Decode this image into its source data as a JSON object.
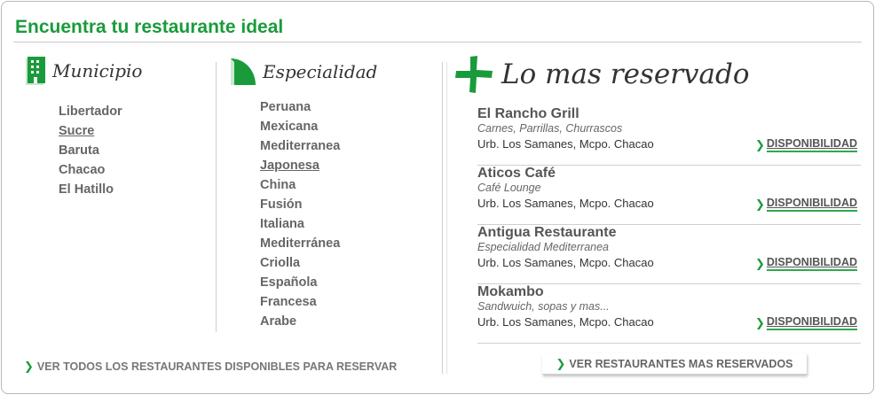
{
  "header": {
    "title": "Encuentra tu restaurante ideal"
  },
  "municipio": {
    "heading": "Municipio",
    "icon": "building-icon",
    "items": [
      {
        "label": "Libertador"
      },
      {
        "label": "Sucre"
      },
      {
        "label": "Baruta"
      },
      {
        "label": "Chacao"
      },
      {
        "label": "El Hatillo"
      }
    ]
  },
  "especialidad": {
    "heading": "Especialidad",
    "icon": "quarter-circle-icon",
    "items": [
      {
        "label": "Peruana"
      },
      {
        "label": "Mexicana"
      },
      {
        "label": "Mediterranea"
      },
      {
        "label": "Japonesa"
      },
      {
        "label": "China"
      },
      {
        "label": "Fusión"
      },
      {
        "label": "Italiana"
      },
      {
        "label": "Mediterránea"
      },
      {
        "label": "Criolla"
      },
      {
        "label": "Española"
      },
      {
        "label": "Francesa"
      },
      {
        "label": "Arabe"
      }
    ]
  },
  "footer_left": {
    "link": "VER TODOS LOS RESTAURANTES DISPONIBLES PARA RESERVAR"
  },
  "most_reserved": {
    "heading": "Lo mas reservado",
    "icon": "plus-icon",
    "restaurants": [
      {
        "name": "El Rancho Grill",
        "tagline": "Carnes, Parrillas, Churrascos",
        "address": "Urb. Los Samanes, Mcpo. Chacao",
        "action": "DISPONIBILIDAD"
      },
      {
        "name": "Aticos Café",
        "tagline": "Café Lounge",
        "address": "Urb. Los Samanes, Mcpo. Chacao",
        "action": "DISPONIBILIDAD"
      },
      {
        "name": "Antigua Restaurante",
        "tagline": "Especialidad Mediterranea",
        "address": "Urb. Los Samanes, Mcpo. Chacao",
        "action": "DISPONIBILIDAD"
      },
      {
        "name": "Mokambo",
        "tagline": "Sandwuich, sopas y mas...",
        "address": "Urb. Los Samanes, Mcpo. Chacao",
        "action": "DISPONIBILIDAD"
      }
    ],
    "button": "VER RESTAURANTES MAS RESERVADOS"
  },
  "colors": {
    "accent": "#1a9b3b",
    "text": "#555555",
    "border": "#b9b9b9"
  }
}
